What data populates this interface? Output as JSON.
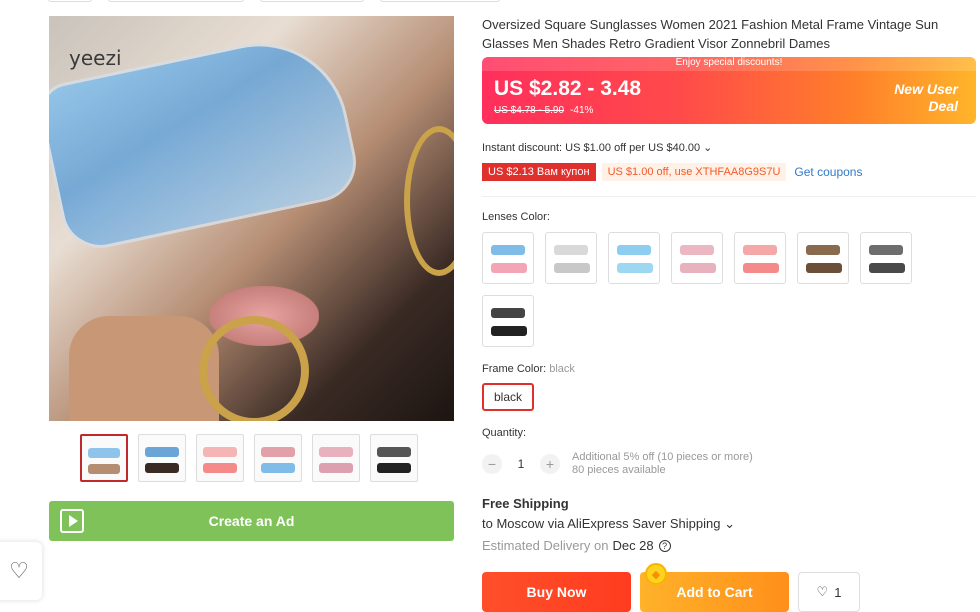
{
  "gallery": {
    "brand_watermark": "yeezi",
    "create_ad_label": "Create an Ad",
    "thumbnails": [
      {
        "colors": [
          "#8ec4ec",
          "#b58d73"
        ]
      },
      {
        "colors": [
          "#6ba4d6",
          "#3a2a24"
        ]
      },
      {
        "colors": [
          "#f5b5b5",
          "#f58a8a"
        ]
      },
      {
        "colors": [
          "#e2a0a8",
          "#7fbde8"
        ]
      },
      {
        "colors": [
          "#e7b2bd",
          "#dca0b0"
        ]
      },
      {
        "colors": [
          "#555555",
          "#222222"
        ]
      }
    ]
  },
  "product": {
    "title": "Oversized Square Sunglasses Women 2021 Fashion Metal Frame Vintage Sun Glasses Men Shades Retro Gradient Visor Zonnebril Dames",
    "price_banner": "Enjoy special discounts!",
    "price_range": "US $2.82 - 3.48",
    "original_price": "US $4.78 - 5.90",
    "discount": "-41%",
    "deal_line1": "New User",
    "deal_line2": "Deal",
    "instant_discount": "Instant discount: US $1.00 off per US $40.00",
    "coupon_red": "US $2.13 Вам купон",
    "coupon_code": "US $1.00 off, use XTHFAA8G9S7U",
    "get_coupons": "Get coupons"
  },
  "options": {
    "lenses_label": "Lenses Color:",
    "lens_swatches": [
      {
        "top": "#7fbde8",
        "bottom": "#f3a5b5"
      },
      {
        "top": "#d9d9d9",
        "bottom": "#c8c8c8"
      },
      {
        "top": "#8ccdf0",
        "bottom": "#9dd8f2"
      },
      {
        "top": "#eab7c2",
        "bottom": "#e7b2bd"
      },
      {
        "top": "#f4a8a8",
        "bottom": "#f58a8a"
      },
      {
        "top": "#8a6a4e",
        "bottom": "#6b4f38"
      },
      {
        "top": "#6d6d6d",
        "bottom": "#4a4a4a"
      },
      {
        "top": "#444444",
        "bottom": "#222222"
      }
    ],
    "frame_label": "Frame Color:",
    "frame_value": "black",
    "frame_chip": "black"
  },
  "quantity": {
    "label": "Quantity:",
    "value": "1",
    "minus": "−",
    "plus": "+",
    "info_line1": "Additional 5% off (10 pieces or more)",
    "info_line2": "80 pieces available"
  },
  "shipping": {
    "title": "Free Shipping",
    "to": "to Moscow via AliExpress Saver Shipping",
    "estimated_label": "Estimated Delivery on",
    "estimated_date": "Dec 28"
  },
  "actions": {
    "buy_now": "Buy Now",
    "add_to_cart": "Add to Cart",
    "wishlist_count": "1"
  }
}
